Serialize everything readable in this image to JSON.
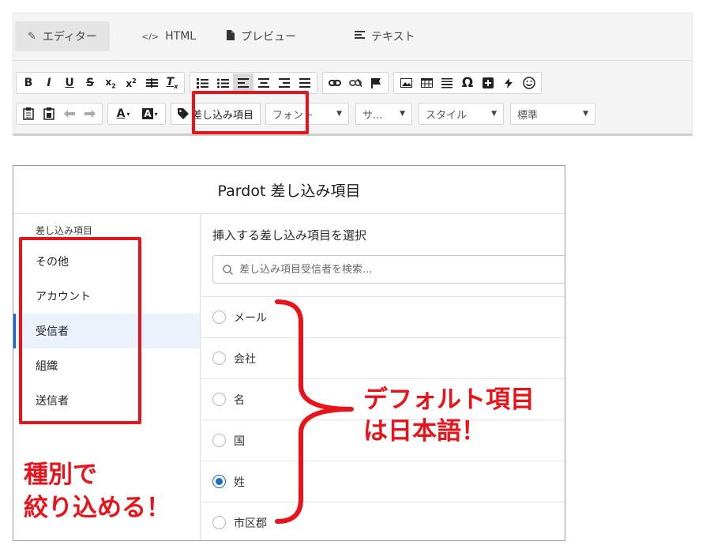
{
  "editor": {
    "tabs": [
      {
        "label": "エディター",
        "icon": "edit-icon"
      },
      {
        "label": "HTML",
        "icon": "code-icon"
      },
      {
        "label": "プレビュー",
        "icon": "document-icon"
      },
      {
        "label": "テキスト",
        "icon": "text-lines-icon"
      }
    ],
    "toolbar": {
      "bold": "B",
      "italic": "I",
      "underline": "U",
      "strike": "S",
      "merge_fields_label": "差し込み項目",
      "font_dropdown": "フォント",
      "size_dropdown": "サ...",
      "style_dropdown": "スタイル",
      "format_dropdown": "標準",
      "omega": "Ω"
    }
  },
  "modal": {
    "title": "Pardot 差し込み項目",
    "sidebar": {
      "title": "差し込み項目",
      "items": [
        "その他",
        "アカウント",
        "受信者",
        "組織",
        "送信者"
      ],
      "selected_index": 2
    },
    "main": {
      "title": "挿入する差し込み項目を選択",
      "search_placeholder": "差し込み項目受信者を検索...",
      "options": [
        "メール",
        "会社",
        "名",
        "国",
        "姓",
        "市区郡"
      ],
      "selected_index": 4
    }
  },
  "annotations": {
    "left_line1": "種別で",
    "left_line2": "絞り込める！",
    "right_line1": "デフォルト項目",
    "right_line2": "は日本語！",
    "highlight_color": "#e8141c"
  }
}
